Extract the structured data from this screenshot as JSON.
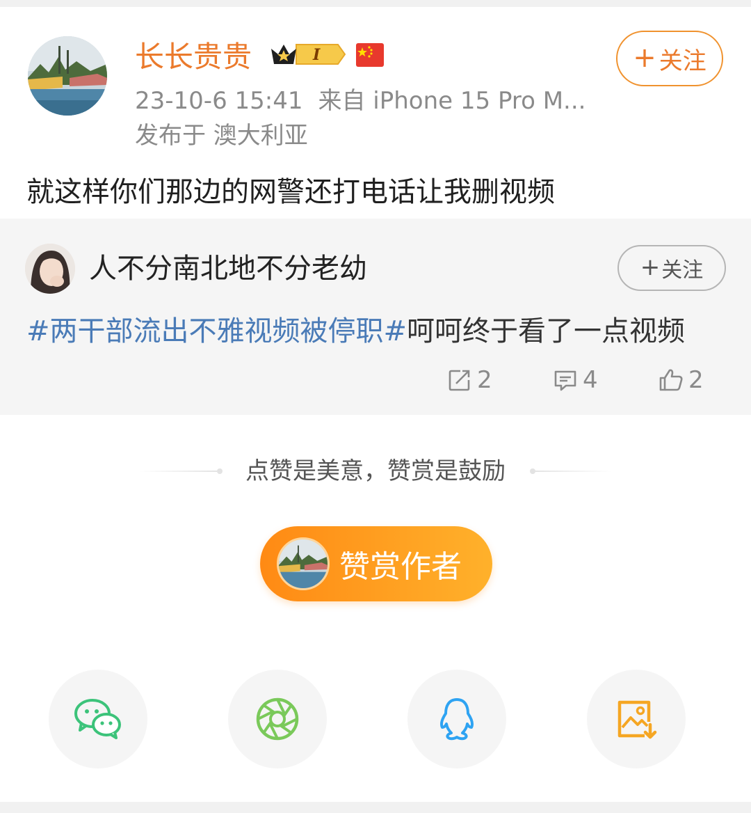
{
  "post": {
    "author": "长长贵贵",
    "rank_badge": "I",
    "time": "23-10-6 15:41",
    "source": "来自 iPhone 15 Pro M...",
    "location": "发布于 澳大利亚",
    "follow_plus": "+",
    "follow_label": "关注",
    "text": "就这样你们那边的网警还打电话让我删视频"
  },
  "repost": {
    "author": "人不分南北地不分老幼",
    "follow_plus": "+",
    "follow_label": "关注",
    "hashtag": "#两干部流出不雅视频被停职#",
    "text": "呵呵终于看了一点视频",
    "reposts": "2",
    "comments": "4",
    "likes": "2"
  },
  "reward": {
    "caption": "点赞是美意，赞赏是鼓励",
    "button_label": "赞赏作者"
  },
  "share": {
    "items": [
      "wechat-icon",
      "moments-icon",
      "qq-icon",
      "save-image-icon"
    ]
  },
  "colors": {
    "accent": "#eb7a2c",
    "hashtag": "#4a7bb7",
    "wechat": "#3cc37a",
    "moments": "#7ac95a",
    "qq": "#2ea3f2",
    "save": "#f5a623"
  }
}
